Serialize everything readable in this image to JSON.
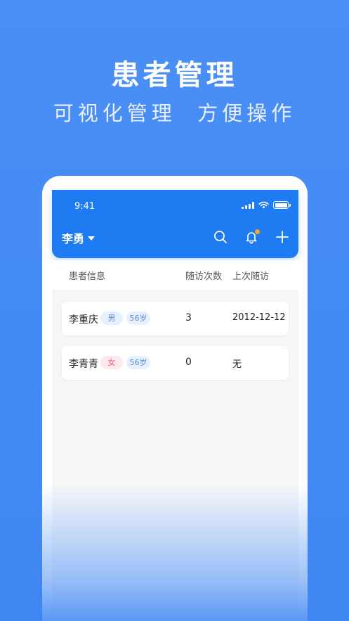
{
  "promo": {
    "title": "患者管理",
    "subtitle": "可视化管理  方便操作"
  },
  "status_bar": {
    "time": "9:41"
  },
  "header": {
    "user_name": "李勇",
    "icons": [
      "search-icon",
      "bell-icon",
      "plus-icon"
    ]
  },
  "table": {
    "columns": [
      "患者信息",
      "随访次数",
      "上次随访"
    ],
    "rows": [
      {
        "name": "李重庆",
        "gender": "男",
        "age": "56岁",
        "visits": "3",
        "last_visit": "2012-12-12"
      },
      {
        "name": "李青青",
        "gender": "女",
        "age": "56岁",
        "visits": "0",
        "last_visit": "无"
      }
    ]
  },
  "colors": {
    "background": "#4a8ff5",
    "header": "#1e7bf2",
    "notification_dot": "#f5a623",
    "male_tag": "#5b8fd6",
    "female_tag": "#e3627a"
  }
}
